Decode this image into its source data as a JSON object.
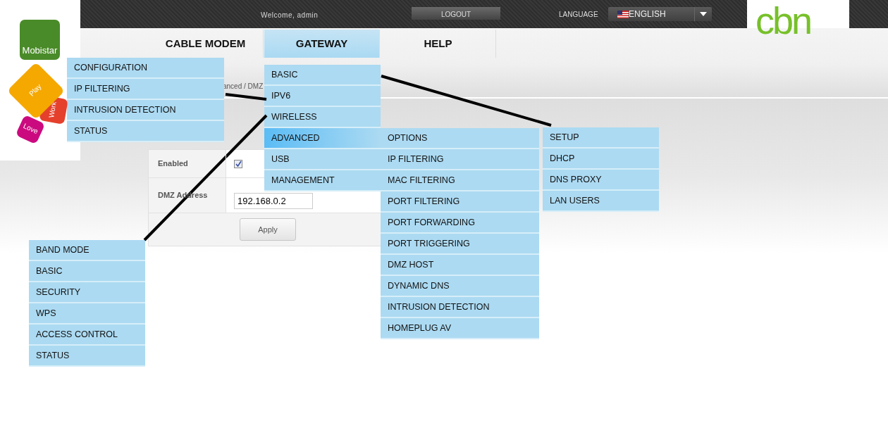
{
  "brand": {
    "mobistar": "Mobistar",
    "tiles": [
      "Play",
      "Work",
      "Love"
    ],
    "cbn": "cbn"
  },
  "topbar": {
    "welcome": "Welcome, admin",
    "logout": "LOGOUT",
    "language_label": "LANGUAGE",
    "language": "ENGLISH"
  },
  "nav": [
    {
      "label": "CABLE MODEM",
      "selected": false
    },
    {
      "label": "GATEWAY",
      "selected": true
    },
    {
      "label": "HELP",
      "selected": false
    }
  ],
  "content": {
    "breadcrumb": "anced / DMZ",
    "enabled_label": "Enabled",
    "enabled_checked": true,
    "address_label": "DMZ Address",
    "address_value": "192.168.0.2",
    "apply": "Apply"
  },
  "menus": [
    {
      "items": [
        {
          "label": "BASIC",
          "selected": false
        },
        {
          "label": "IPV6",
          "selected": false
        },
        {
          "label": "WIRELESS",
          "selected": false
        },
        {
          "label": "ADVANCED",
          "selected": true
        },
        {
          "label": "USB",
          "selected": false
        },
        {
          "label": "MANAGEMENT",
          "selected": false
        }
      ]
    },
    {
      "items": [
        {
          "label": "CONFIGURATION",
          "selected": false
        },
        {
          "label": "IP FILTERING",
          "selected": false
        },
        {
          "label": "INTRUSION DETECTION",
          "selected": false
        },
        {
          "label": "STATUS",
          "selected": false
        }
      ]
    },
    {
      "items": [
        {
          "label": "OPTIONS",
          "selected": false
        },
        {
          "label": "IP FILTERING",
          "selected": false
        },
        {
          "label": "MAC FILTERING",
          "selected": false
        },
        {
          "label": "PORT FILTERING",
          "selected": false
        },
        {
          "label": "PORT FORWARDING",
          "selected": false
        },
        {
          "label": "PORT TRIGGERING",
          "selected": false
        },
        {
          "label": "DMZ HOST",
          "selected": false
        },
        {
          "label": "DYNAMIC DNS",
          "selected": false
        },
        {
          "label": "INTRUSION DETECTION",
          "selected": false
        },
        {
          "label": "HOMEPLUG AV",
          "selected": false
        }
      ]
    },
    {
      "items": [
        {
          "label": "SETUP",
          "selected": false
        },
        {
          "label": "DHCP",
          "selected": false
        },
        {
          "label": "DNS PROXY",
          "selected": false
        },
        {
          "label": "LAN USERS",
          "selected": false
        }
      ]
    },
    {
      "items": [
        {
          "label": "BAND MODE",
          "selected": false
        },
        {
          "label": "BASIC",
          "selected": false
        },
        {
          "label": "SECURITY",
          "selected": false
        },
        {
          "label": "WPS",
          "selected": false
        },
        {
          "label": "ACCESS CONTROL",
          "selected": false
        },
        {
          "label": "STATUS",
          "selected": false
        }
      ]
    }
  ]
}
